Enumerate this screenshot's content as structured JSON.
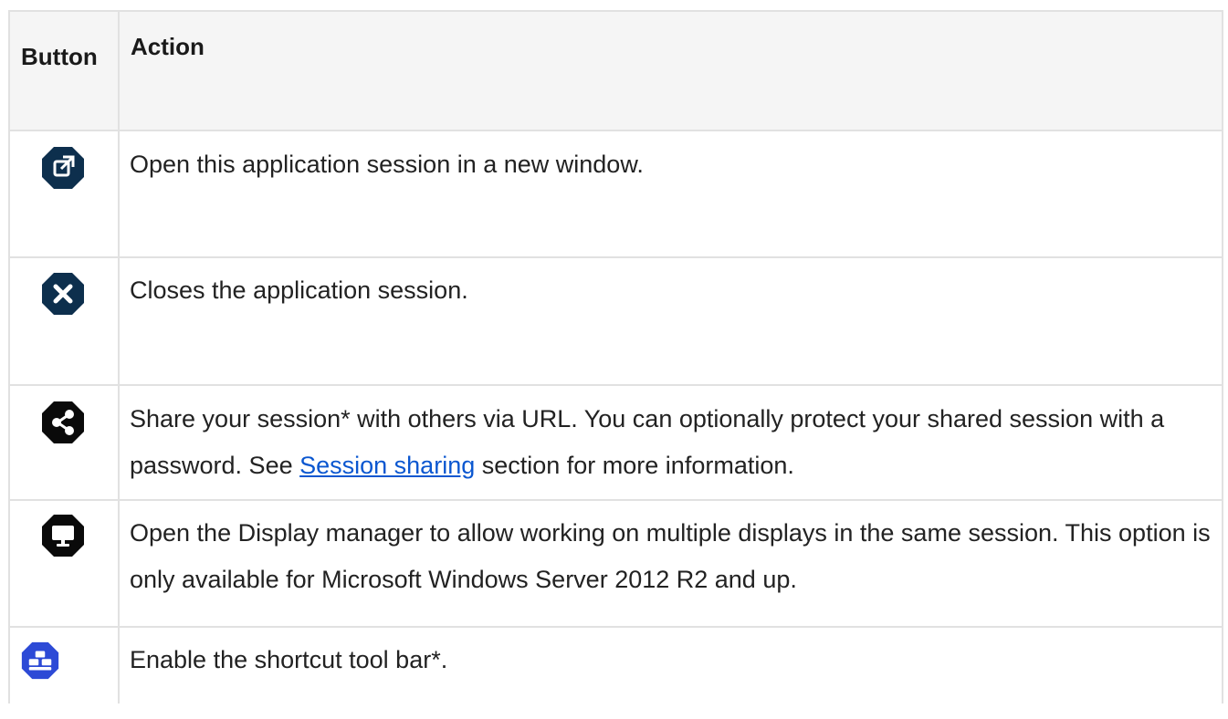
{
  "table": {
    "header": {
      "button": "Button",
      "action": "Action"
    },
    "rows": [
      {
        "icon": "open-in-new-window-icon",
        "action": "Open this application session in a new window."
      },
      {
        "icon": "close-session-icon",
        "action": "Closes the application session."
      },
      {
        "icon": "share-icon",
        "action_pre": "Share your session* with others via URL. You can optionally protect your shared session with a password. See ",
        "link": "Session sharing",
        "action_post": " section for more information."
      },
      {
        "icon": "display-manager-icon",
        "action": "Open the Display manager to allow working on multiple displays in the same session. This option is only available for Microsoft Windows Server 2012 R2 and up."
      },
      {
        "icon": "shortcut-toolbar-icon",
        "action": "Enable the shortcut tool bar*."
      }
    ]
  },
  "colors": {
    "icon_dark": "#0d2f4d",
    "icon_black": "#0a0a0a",
    "icon_blue": "#2d4ad6",
    "link": "#0b57d0",
    "border": "#e1e1e1",
    "header_bg": "#f5f5f5"
  }
}
